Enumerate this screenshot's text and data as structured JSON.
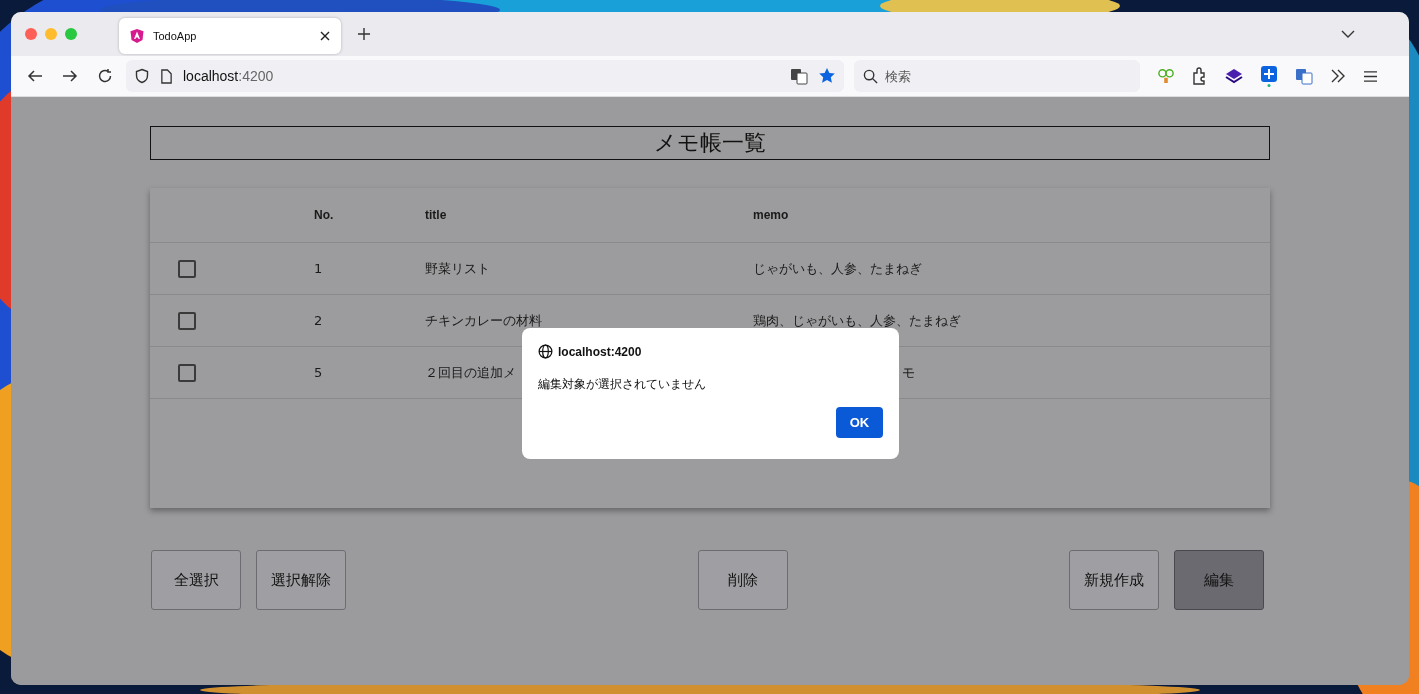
{
  "browser": {
    "tabs": [
      {
        "title": "TodoApp",
        "selected": true
      }
    ],
    "url": {
      "host": "localhost",
      "port": ":4200"
    },
    "search": {
      "placeholder": "検索"
    }
  },
  "page": {
    "heading": "メモ帳一覧",
    "table": {
      "columns": [
        "No.",
        "title",
        "memo"
      ],
      "rows": [
        {
          "checked": false,
          "no": "1",
          "title": "野菜リスト",
          "memo": "じゃがいも、人参、たまねぎ"
        },
        {
          "checked": false,
          "no": "2",
          "title": "チキンカレーの材料",
          "memo": "鶏肉、じゃがいも、人参、たまねぎ"
        },
        {
          "checked": false,
          "no": "5",
          "title": "２回目の追加メ",
          "memo_tail": "モ"
        }
      ]
    },
    "buttons": {
      "left": [
        {
          "label": "全選択",
          "pressed": false
        },
        {
          "label": "選択解除",
          "pressed": false
        }
      ],
      "center": [
        {
          "label": "削除",
          "pressed": false
        }
      ],
      "right": [
        {
          "label": "新規作成",
          "pressed": false
        },
        {
          "label": "編集",
          "pressed": true
        }
      ]
    }
  },
  "dialog": {
    "origin": "localhost:4200",
    "message": "編集対象が選択されていません",
    "button": "OK"
  }
}
